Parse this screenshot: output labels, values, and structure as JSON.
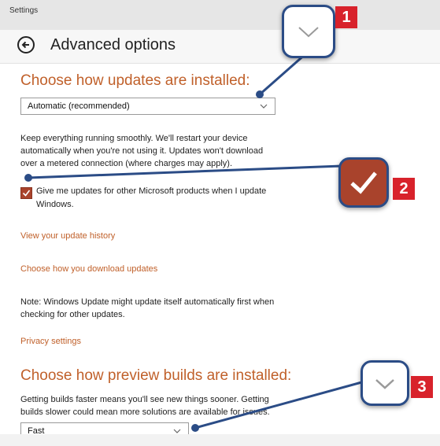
{
  "window": {
    "title": "Settings"
  },
  "header": {
    "title": "Advanced options"
  },
  "updates": {
    "heading": "Choose how updates are installed:",
    "dropdown_value": "Automatic (recommended)",
    "description": [
      "Keep everything running smoothly. We'll restart your device",
      "automatically when you're not using it. Updates won't download",
      "over a metered connection (where charges may apply)."
    ],
    "checkbox_label": [
      "Give me updates for other Microsoft products when I update",
      "Windows."
    ],
    "checkbox_checked": true
  },
  "links": {
    "history": "View your update history",
    "download": "Choose how you download updates",
    "privacy": "Privacy settings"
  },
  "note": [
    "Note: Windows Update might update itself automatically first when",
    "checking for other updates."
  ],
  "preview": {
    "heading": "Choose how preview builds are installed:",
    "description": [
      "Getting builds faster means you'll see new things sooner. Getting",
      "builds slower could mean more solutions are available for issues."
    ],
    "dropdown_value": "Fast"
  },
  "callouts": [
    "1",
    "2",
    "3"
  ],
  "colors": {
    "accent": "#c0602a",
    "checkbox": "#a9432c",
    "callout_border": "#2b4c86",
    "badge": "#d8222b"
  }
}
